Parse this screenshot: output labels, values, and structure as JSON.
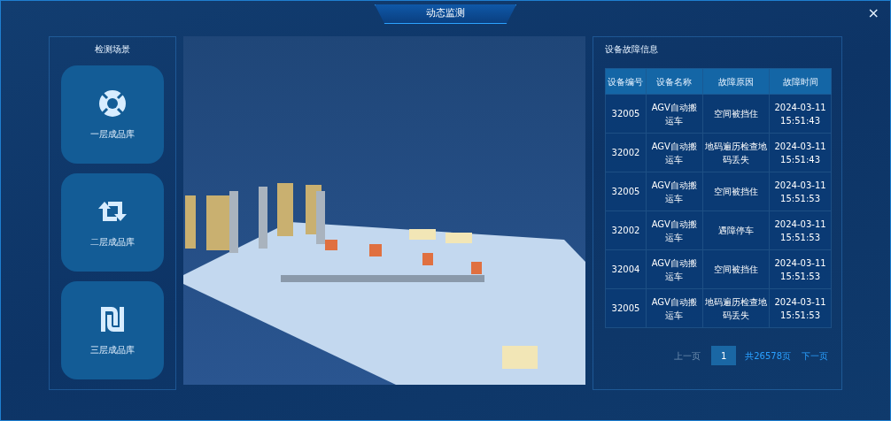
{
  "window": {
    "title": "动态监测",
    "close": "×"
  },
  "scenes": {
    "title": "检测场景",
    "items": [
      {
        "label": "一层成品库"
      },
      {
        "label": "二层成品库"
      },
      {
        "label": "三层成品库"
      }
    ]
  },
  "faults": {
    "title": "设备故障信息",
    "table": {
      "columns": [
        "设备编号",
        "设备名称",
        "故障原因",
        "故障时间"
      ],
      "rows": [
        [
          "32005",
          "AGV自动搬运车",
          "空间被挡住",
          "2024-03-11 15:51:43"
        ],
        [
          "32002",
          "AGV自动搬运车",
          "地码遍历检查地码丢失",
          "2024-03-11 15:51:43"
        ],
        [
          "32005",
          "AGV自动搬运车",
          "空间被挡住",
          "2024-03-11 15:51:53"
        ],
        [
          "32002",
          "AGV自动搬运车",
          "遇障停车",
          "2024-03-11 15:51:53"
        ],
        [
          "32004",
          "AGV自动搬运车",
          "空间被挡住",
          "2024-03-11 15:51:53"
        ],
        [
          "32005",
          "AGV自动搬运车",
          "地码遍历检查地码丢失",
          "2024-03-11 15:51:53"
        ]
      ]
    },
    "pagination": {
      "prev": {
        "label": "上一页",
        "disabled": true
      },
      "pages": [
        {
          "label": "1",
          "selected": true
        }
      ],
      "total": "共26578页",
      "next": {
        "label": "下一页",
        "disabled": false
      }
    }
  }
}
